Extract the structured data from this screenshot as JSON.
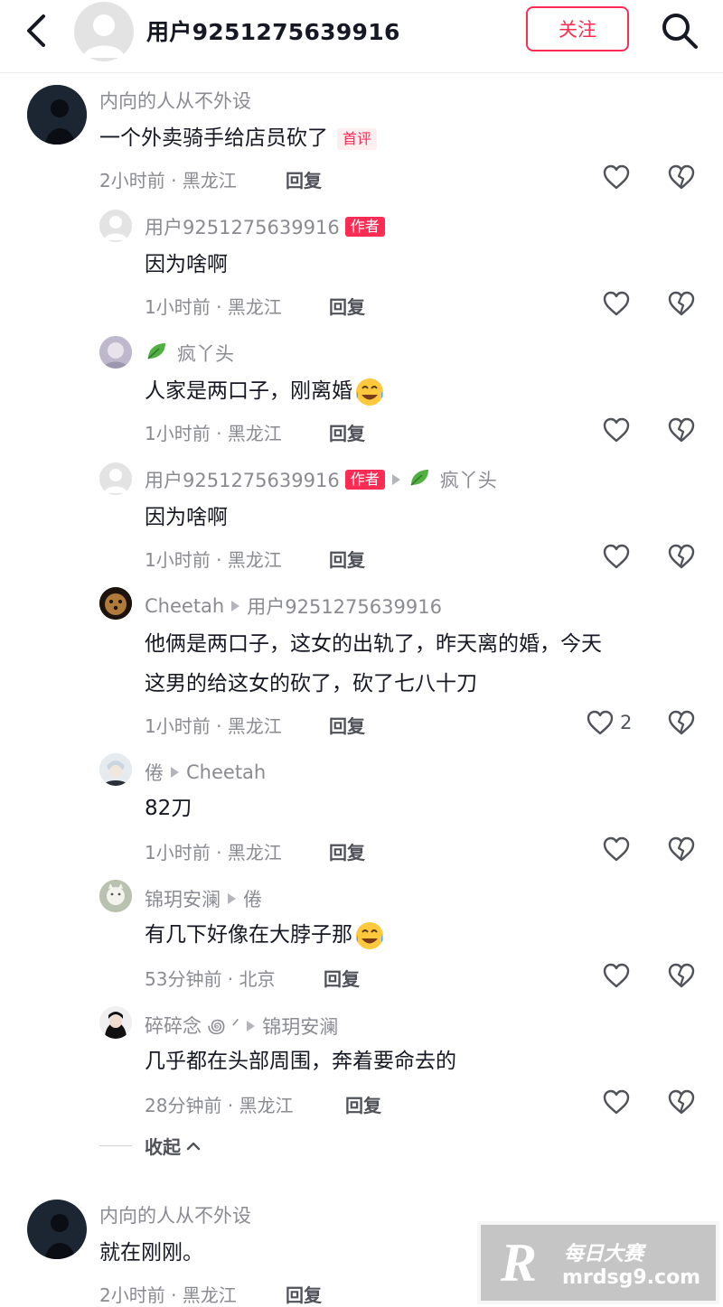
{
  "header": {
    "title": "用户9251275639916",
    "follow_label": "关注"
  },
  "comments": [
    {
      "user": "内向的人从不外设",
      "text": "一个外卖骑手给店员砍了",
      "tag": "首评",
      "meta": "2小时前 · 黑龙江",
      "reply": "回复",
      "replies": [
        {
          "user": "用户9251275639916",
          "author_tag": "作者",
          "text": "因为啥啊",
          "meta": "1小时前 · 黑龙江",
          "reply": "回复"
        },
        {
          "user": "疯丫头",
          "text": "人家是两口子，刚离婚",
          "meta": "1小时前 · 黑龙江",
          "reply": "回复"
        },
        {
          "user": "用户9251275639916",
          "author_tag": "作者",
          "reply_to": "疯丫头",
          "text": "因为啥啊",
          "meta": "1小时前 · 黑龙江",
          "reply": "回复"
        },
        {
          "user": "Cheetah",
          "reply_to": "用户9251275639916",
          "text_line1": "他俩是两口子，这女的出轨了，昨天离的婚，今天",
          "text_line2": "这男的给这女的砍了，砍了七八十刀",
          "meta": "1小时前 · 黑龙江",
          "reply": "回复",
          "likes": "2"
        },
        {
          "user": "倦",
          "reply_to": "Cheetah",
          "text": "82刀",
          "meta": "1小时前 · 黑龙江",
          "reply": "回复"
        },
        {
          "user": "锦玥安澜",
          "reply_to": "倦",
          "text": "有几下好像在大脖子那",
          "meta": "53分钟前 · 北京",
          "reply": "回复"
        },
        {
          "user": "碎碎念 ꩜ ᐟ ",
          "reply_to": "锦玥安澜",
          "text": "几乎都在头部周围，奔着要命去的",
          "meta": "28分钟前 · 黑龙江",
          "reply": "回复"
        }
      ]
    },
    {
      "user": "内向的人从不外设",
      "text": "就在刚刚。",
      "meta": "2小时前 · 黑龙江",
      "reply": "回复"
    }
  ],
  "collapse_label": "收起",
  "watermark": {
    "logo": "R",
    "line1": "每日大赛",
    "line2": "mrdsg9.com"
  },
  "colors": {
    "accent": "#fe2c55",
    "meta": "#8a8b91",
    "text": "#161823"
  }
}
